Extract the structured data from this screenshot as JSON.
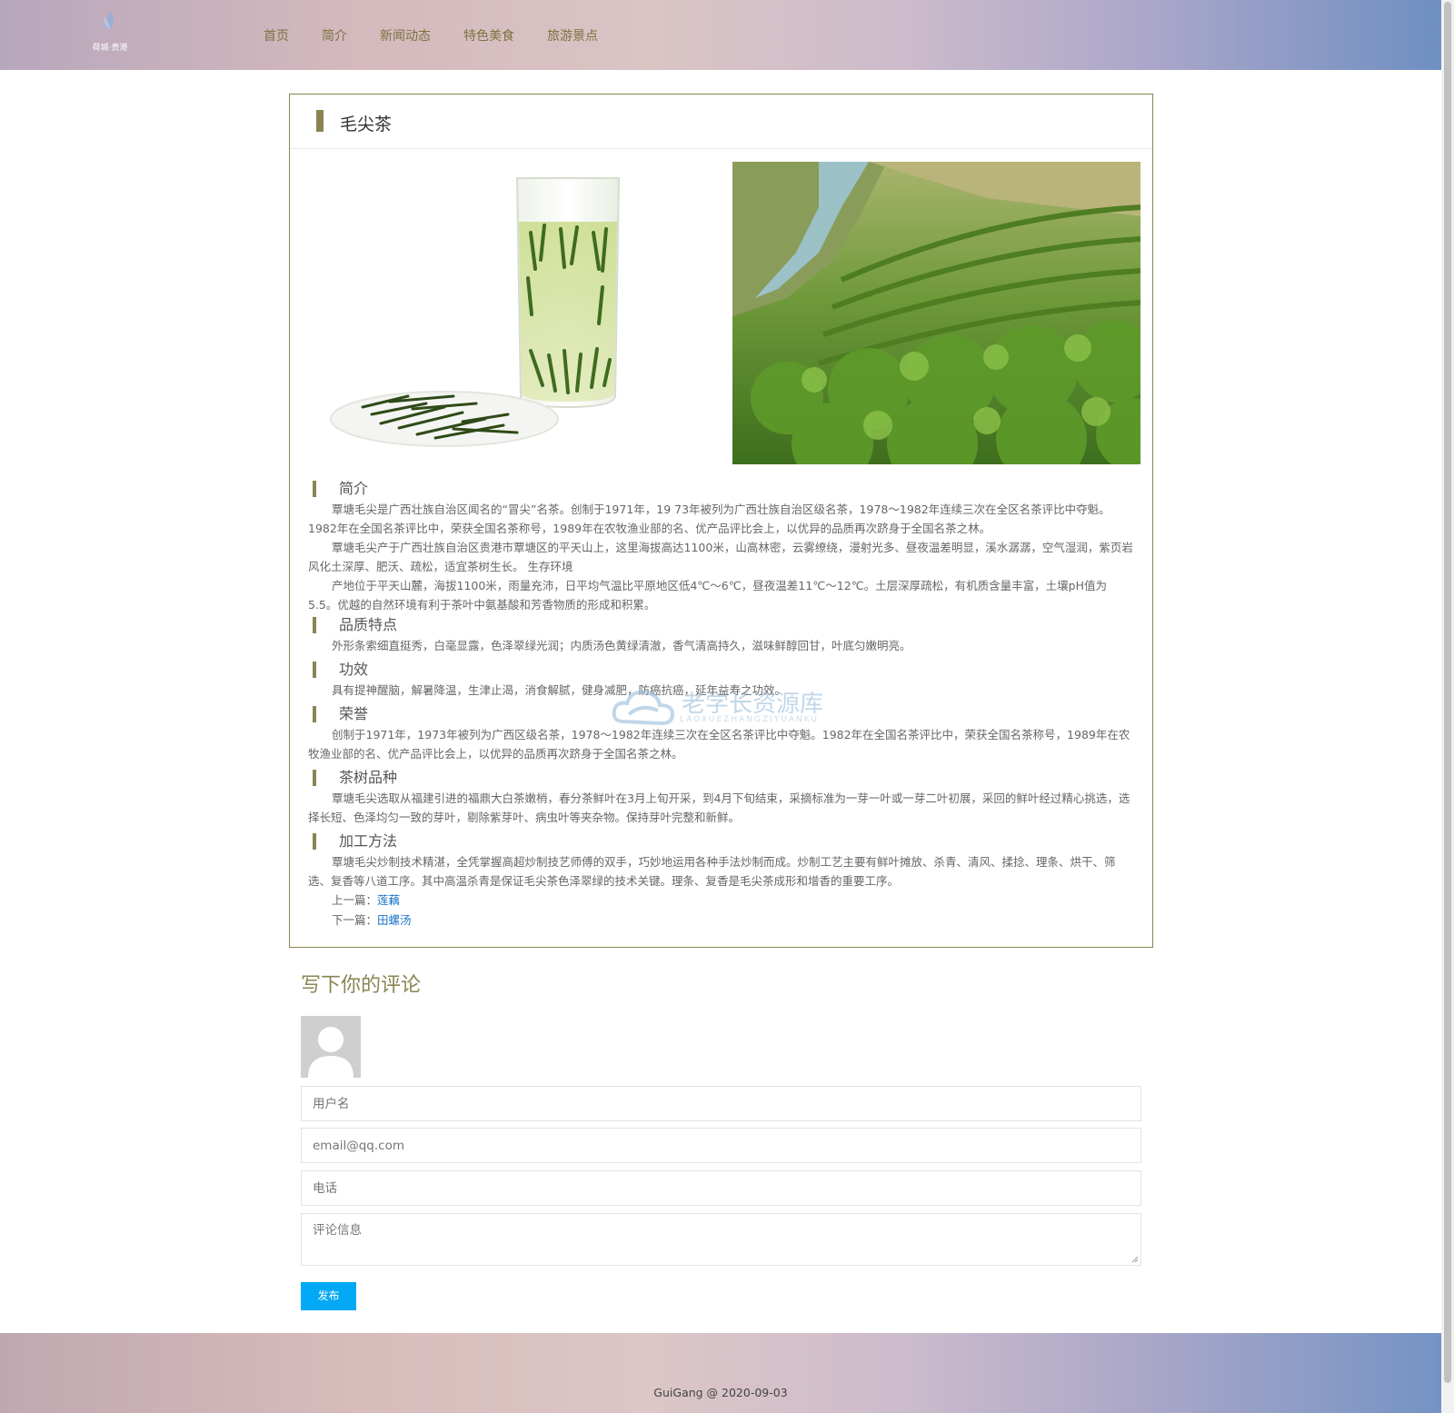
{
  "header": {
    "logo_text": "荷城·贵港",
    "nav": [
      "首页",
      "简介",
      "新闻动态",
      "特色美食",
      "旅游景点"
    ]
  },
  "article": {
    "title": "毛尖茶",
    "sections": [
      {
        "heading": "简介",
        "paragraphs": [
          "覃塘毛尖是广西壮族自治区闻名的“冒尖”名茶。创制于1971年，19 73年被列为广西壮族自治区级名茶，1978～1982年连续三次在全区名茶评比中夺魁。1982年在全国名茶评比中，荣获全国名茶称号，1989年在农牧渔业部的名、优产品评比会上，以优异的品质再次跻身于全国名茶之林。",
          "覃塘毛尖产于广西壮族自治区贵港市覃塘区的平天山上，这里海拔高达1100米，山高林密，云雾缭绕，漫射光多、昼夜温差明显，溪水潺潺，空气湿润，紫页岩风化土深厚、肥沃、疏松，适宜茶树生长。 生存环境",
          "产地位于平天山麓，海拔1100米，雨量充沛，日平均气温比平原地区低4℃～6℃，昼夜温差11℃～12℃。土层深厚疏松，有机质含量丰富，土壤pH值为5.5。优越的自然环境有利于茶叶中氨基酸和芳香物质的形成和积累。"
        ]
      },
      {
        "heading": "品质特点",
        "paragraphs": [
          "外形条索细直挺秀，白毫显露，色泽翠绿光润；内质汤色黄绿清澈，香气清高持久，滋味鲜醇回甘，叶底匀嫩明亮。"
        ]
      },
      {
        "heading": "功效",
        "paragraphs": [
          "具有提神醒脑，解暑降温，生津止渴，消食解腻，健身减肥，防癌抗癌，延年益寿之功效。"
        ]
      },
      {
        "heading": "荣誉",
        "paragraphs": [
          "创制于1971年，1973年被列为广西区级名茶，1978～1982年连续三次在全区名茶评比中夺魁。1982年在全国名茶评比中，荣获全国名茶称号，1989年在农牧渔业部的名、优产品评比会上，以优异的品质再次跻身于全国名茶之林。"
        ]
      },
      {
        "heading": "茶树品种",
        "paragraphs": [
          "覃塘毛尖选取从福建引进的福鼎大白茶嫩梢，春分茶鲜叶在3月上旬开采，到4月下旬结束，采摘标准为一芽一叶或一芽二叶初展，采回的鲜叶经过精心挑选，选择长短、色泽均匀一致的芽叶，剔除紫芽叶、病虫叶等夹杂物。保持芽叶完整和新鲜。"
        ]
      },
      {
        "heading": "加工方法",
        "paragraphs": [
          "覃塘毛尖炒制技术精湛，全凭掌握高超炒制技艺师傅的双手，巧妙地运用各种手法炒制而成。炒制工艺主要有鲜叶摊放、杀青、清风、揉捻、理条、烘干、筛选、复香等八道工序。其中高温杀青是保证毛尖茶色泽翠绿的技术关键。理条、复香是毛尖茶成形和增香的重要工序。"
        ]
      }
    ],
    "prev_label": "上一篇：",
    "prev_link": "莲藕",
    "next_label": "下一篇：",
    "next_link": "田螺汤"
  },
  "watermark": {
    "cn": "老学长资源库",
    "en": "LAOXUEZHANGZIYUANKU"
  },
  "comment": {
    "title": "写下你的评论",
    "username_placeholder": "用户名",
    "email_placeholder": "email@qq.com",
    "phone_placeholder": "电话",
    "message_placeholder": "评论信息",
    "submit_label": "发布"
  },
  "footer": {
    "text": "GuiGang @ 2020-09-03"
  }
}
